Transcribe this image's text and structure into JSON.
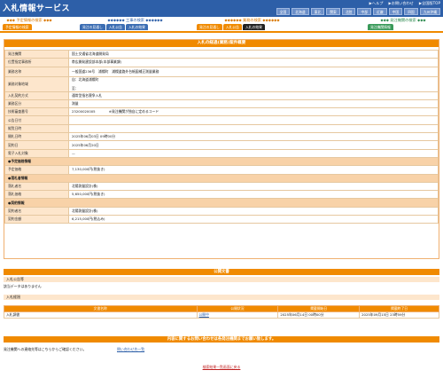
{
  "header": {
    "title": "入札情報サービス",
    "links": [
      "▶ヘルプ",
      "▶お問い合わせ",
      "▶全国版TOP"
    ],
    "regions": [
      "全国",
      "北海道",
      "東北",
      "関東",
      "北陸",
      "中部",
      "近畿",
      "中国",
      "四国",
      "九州沖縄"
    ]
  },
  "nav": {
    "groups": [
      {
        "title": "◆◆◆ 予定情報の検索 ◆◆◆",
        "tabs": [
          "予定情報の検索"
        ]
      },
      {
        "title": "◆◆◆◆◆◆ 工事の検索 ◆◆◆◆◆◆",
        "tabs": [
          "発注の見通し",
          "入札公告",
          "入札の結果"
        ]
      },
      {
        "title": "◆◆◆◆◆◆ 業務の検索 ◆◆◆◆◆◆",
        "tabs": [
          "発注の見通し",
          "入札公告",
          "入札の結果"
        ]
      },
      {
        "title": "◆◆◆ 発注機関の検索 ◆◆◆",
        "tabs": [
          "発注機関情報"
        ]
      }
    ]
  },
  "panel": {
    "title": "入札の経過(業務)案件概要",
    "rows": [
      {
        "label": "発注機関",
        "value": "国土交通省北海道開発局"
      },
      {
        "label": "位置指定事務所",
        "value": "帯広開発建設部本部(本部事業課)"
      },
      {
        "label": "業務名称",
        "value": "一般国道236号　浦幌町　浦幌道路外台帳図補正測量業務"
      },
      {
        "label": "業務対象地域",
        "value": "自：北海道浦幌町",
        "value2": "至：",
        "tall": true
      },
      {
        "label": "入札契約方式",
        "value": "通常型指名競争入札"
      },
      {
        "label": "業務区分",
        "value": "測量"
      },
      {
        "label": "技術審査番号",
        "value": "23200020005",
        "note": "※発注機関が独自に定めるコード"
      },
      {
        "label": "公告日付",
        "value": ""
      },
      {
        "label": "縦覧日時",
        "value": ""
      },
      {
        "label": "開札日時",
        "value": "2025年06月03日 09時00分"
      },
      {
        "label": "契約日",
        "value": "2025年06月20日"
      },
      {
        "label": "電子入札対象",
        "value": "—"
      },
      {
        "section": "●予定価格情報"
      },
      {
        "label": "予定価格",
        "value": "7,130,000円(税抜き)"
      },
      {
        "section": "●落札者情報"
      },
      {
        "label": "落札者名",
        "value": "北陽測量設計(株)"
      },
      {
        "label": "落札価格",
        "value": "5,650,000円(税抜き)"
      },
      {
        "section": "●契約情報"
      },
      {
        "label": "契約者名",
        "value": "北陽測量設計(株)"
      },
      {
        "label": "契約金額",
        "value": "6,215,000円(税込み)"
      }
    ]
  },
  "docs": {
    "title": "公開文書",
    "notice_head": "入札公告等",
    "notice_text": "該当データはありません",
    "result_head": "入札経過",
    "columns": [
      "文書名称",
      "公開状況",
      "掲載開始日",
      "掲載終了日"
    ],
    "rows": [
      {
        "name": "入札調書",
        "status": "公開中",
        "start": "2025年06月14日 00時00分",
        "end": "2025年09月15日 23時59分"
      }
    ]
  },
  "footer": {
    "bar": "内容に関するお問い合わせは各発注機関までお願い致します。",
    "text": "発注機関への連絡先等はこちらからご確認ください。",
    "link": "問い合わせ先一覧",
    "back": "検索結果一覧画面に戻る"
  }
}
